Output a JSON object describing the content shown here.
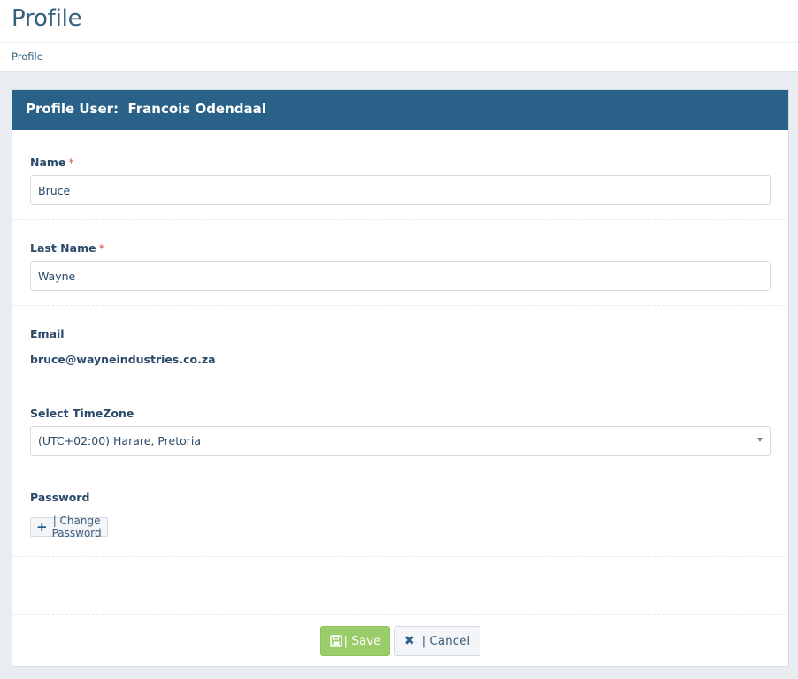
{
  "header": {
    "title": "Profile",
    "breadcrumb": "Profile"
  },
  "panel": {
    "title": "Profile User:  Francois Odendaal"
  },
  "form": {
    "name": {
      "label": "Name",
      "required_mark": "*",
      "value": "Bruce"
    },
    "last_name": {
      "label": "Last Name",
      "required_mark": "*",
      "value": "Wayne"
    },
    "email": {
      "label": "Email",
      "value": "bruce@wayneindustries.co.za"
    },
    "timezone": {
      "label": "Select TimeZone",
      "selected": "(UTC+02:00) Harare, Pretoria"
    },
    "password": {
      "label": "Password",
      "change_button": "| Change Password"
    }
  },
  "actions": {
    "save_label": "| Save",
    "cancel_label": "| Cancel"
  },
  "colors": {
    "panel_header": "#2a6188",
    "save_button": "#9acd6a",
    "required": "#d9534f"
  },
  "icons": {
    "change_password": "plus-icon",
    "save": "floppy-disk-icon",
    "cancel": "close-icon",
    "select_caret": "caret-down-icon"
  }
}
